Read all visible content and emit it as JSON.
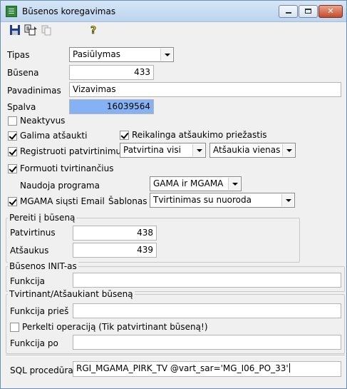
{
  "window": {
    "title": "Būsenos koregavimas",
    "minimize_icon": "minimize-icon",
    "maximize_icon": "maximize-icon",
    "close_icon": "close-icon"
  },
  "toolbar": {
    "save_icon": "save-icon",
    "copy_icon": "copy-settings-icon",
    "paste_icon": "paste-icon",
    "help_icon": "help-icon"
  },
  "form": {
    "tipas_label": "Tipas",
    "tipas_value": "Pasiūlymas",
    "busena_label": "Būsena",
    "busena_value": "433",
    "pavadinimas_label": "Pavadinimas",
    "pavadinimas_value": "Vizavimas",
    "spalva_label": "Spalva",
    "spalva_value": "16039564",
    "spalva_color": "#84b2f5",
    "neaktyvus_label": "Neaktyvus",
    "neaktyvus_checked": false,
    "galima_label": "Galima atšaukti",
    "galima_checked": true,
    "reikalinga_label": "Reikalinga atšaukimo priežastis",
    "reikalinga_checked": true,
    "registruoti_label": "Registruoti patvirtinimus",
    "registruoti_checked": true,
    "patvirtina_value": "Patvirtina visi",
    "atsaukia_value": "Atšaukia vienas",
    "formuoti_label": "Formuoti tvirtinančius",
    "formuoti_checked": true,
    "naudoja_label": "Naudoja programa",
    "naudoja_value": "GAMA ir MGAMA",
    "mgama_label": "MGAMA siųsti Email",
    "mgama_checked": true,
    "sablonas_label": "Šablonas",
    "sablonas_value": "Tvirtinimas su nuoroda"
  },
  "pereiti": {
    "legend": "Pereiti į būseną",
    "patvirtinus_label": "Patvirtinus",
    "patvirtinus_value": "438",
    "atsaukus_label": "Atšaukus",
    "atsaukus_value": "439"
  },
  "init": {
    "legend": "Būsenos INIT-as",
    "funkcija_label": "Funkcija",
    "funkcija_value": ""
  },
  "tvirtinant": {
    "legend": "Tvirtinant/Atšaukiant būseną",
    "pries_label": "Funkcija prieš",
    "pries_value": "",
    "perkelti_label": "Perkelti operaciją (Tik patvirtinant būseną!)",
    "perkelti_checked": false,
    "po_label": "Funkcija po",
    "po_value": ""
  },
  "sql": {
    "label": "SQL procedūra",
    "value": "RGI_MGAMA_PIRK_TV @vart_sar='MG_I06_PO_33'"
  }
}
